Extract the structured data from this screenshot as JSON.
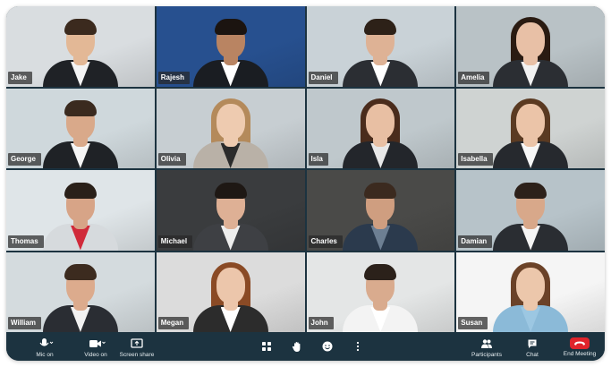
{
  "participants": [
    {
      "name": "Jake",
      "bg": "#d9dde0",
      "suit": "#1f2226",
      "shirt": "#f4f4f4",
      "hair": "#3b2a1e",
      "skin": "#e3b896",
      "long": false
    },
    {
      "name": "Rajesh",
      "bg": "#27508f",
      "suit": "#1a1d22",
      "shirt": "#ffffff",
      "hair": "#1b1410",
      "skin": "#b98462",
      "long": false
    },
    {
      "name": "Daniel",
      "bg": "#c9d2d7",
      "suit": "#2b2e33",
      "shirt": "#ffffff",
      "hair": "#2d2118",
      "skin": "#deb295",
      "long": false
    },
    {
      "name": "Amelia",
      "bg": "#b9c2c6",
      "suit": "#2b2e33",
      "shirt": "#f2f2f2",
      "hair": "#2a1b12",
      "skin": "#e8c0a6",
      "long": true
    },
    {
      "name": "George",
      "bg": "#cfd8dc",
      "suit": "#1f2226",
      "shirt": "#f5f5f5",
      "hair": "#3a2a1f",
      "skin": "#d9a98a",
      "long": false
    },
    {
      "name": "Olivia",
      "bg": "#c7ced2",
      "suit": "#b9b1a7",
      "shirt": "#2b2b2b",
      "hair": "#b48a5b",
      "skin": "#eecbb0",
      "long": true
    },
    {
      "name": "Isla",
      "bg": "#bfc8cc",
      "suit": "#23262b",
      "shirt": "#e8e8e8",
      "hair": "#4a2c1c",
      "skin": "#e8bfa3",
      "long": true
    },
    {
      "name": "Isabella",
      "bg": "#cfd3d2",
      "suit": "#26292e",
      "shirt": "#f7f7f7",
      "hair": "#5a3a22",
      "skin": "#ebc4a8",
      "long": true
    },
    {
      "name": "Thomas",
      "bg": "#dfe5e8",
      "suit": "#d6dadd",
      "shirt": "#d02a3a",
      "hair": "#2a2019",
      "skin": "#d7a487",
      "long": false
    },
    {
      "name": "Michael",
      "bg": "#3a3c3e",
      "suit": "#3e4044",
      "shirt": "#eeeeee",
      "hair": "#1e1814",
      "skin": "#deb095",
      "long": false
    },
    {
      "name": "Charles",
      "bg": "#4a4a48",
      "suit": "#2b3a4d",
      "shirt": "#6d7f93",
      "hair": "#3b2a1f",
      "skin": "#cf9e80",
      "long": false
    },
    {
      "name": "Damian",
      "bg": "#b7c3c9",
      "suit": "#2a2d32",
      "shirt": "#f5f5f5",
      "hair": "#2d211a",
      "skin": "#d8a88a",
      "long": false
    },
    {
      "name": "William",
      "bg": "#d4dbde",
      "suit": "#2a2d33",
      "shirt": "#f2f2f2",
      "hair": "#3c2b1f",
      "skin": "#dcab8d",
      "long": false
    },
    {
      "name": "Megan",
      "bg": "#dcdcdc",
      "suit": "#2c2c2c",
      "shirt": "#ffffff",
      "hair": "#8a4a25",
      "skin": "#ecc6ab",
      "long": true
    },
    {
      "name": "John",
      "bg": "#e4e6e6",
      "suit": "#f3f3f3",
      "shirt": "#ffffff",
      "hair": "#2b211a",
      "skin": "#d9ab8e",
      "long": false
    },
    {
      "name": "Susan",
      "bg": "#f5f5f5",
      "suit": "#8bbad8",
      "shirt": "#9cc7e2",
      "hair": "#6b4228",
      "skin": "#ecc7ab",
      "long": true
    }
  ],
  "toolbar": {
    "mic_label": "Mic on",
    "video_label": "Video on",
    "screen_share_label": "Screen share",
    "participants_label": "Participants",
    "chat_label": "Chat",
    "end_meeting_label": "End Meeting"
  },
  "colors": {
    "end_meeting": "#e0242b",
    "toolbar": "#1c3340"
  }
}
